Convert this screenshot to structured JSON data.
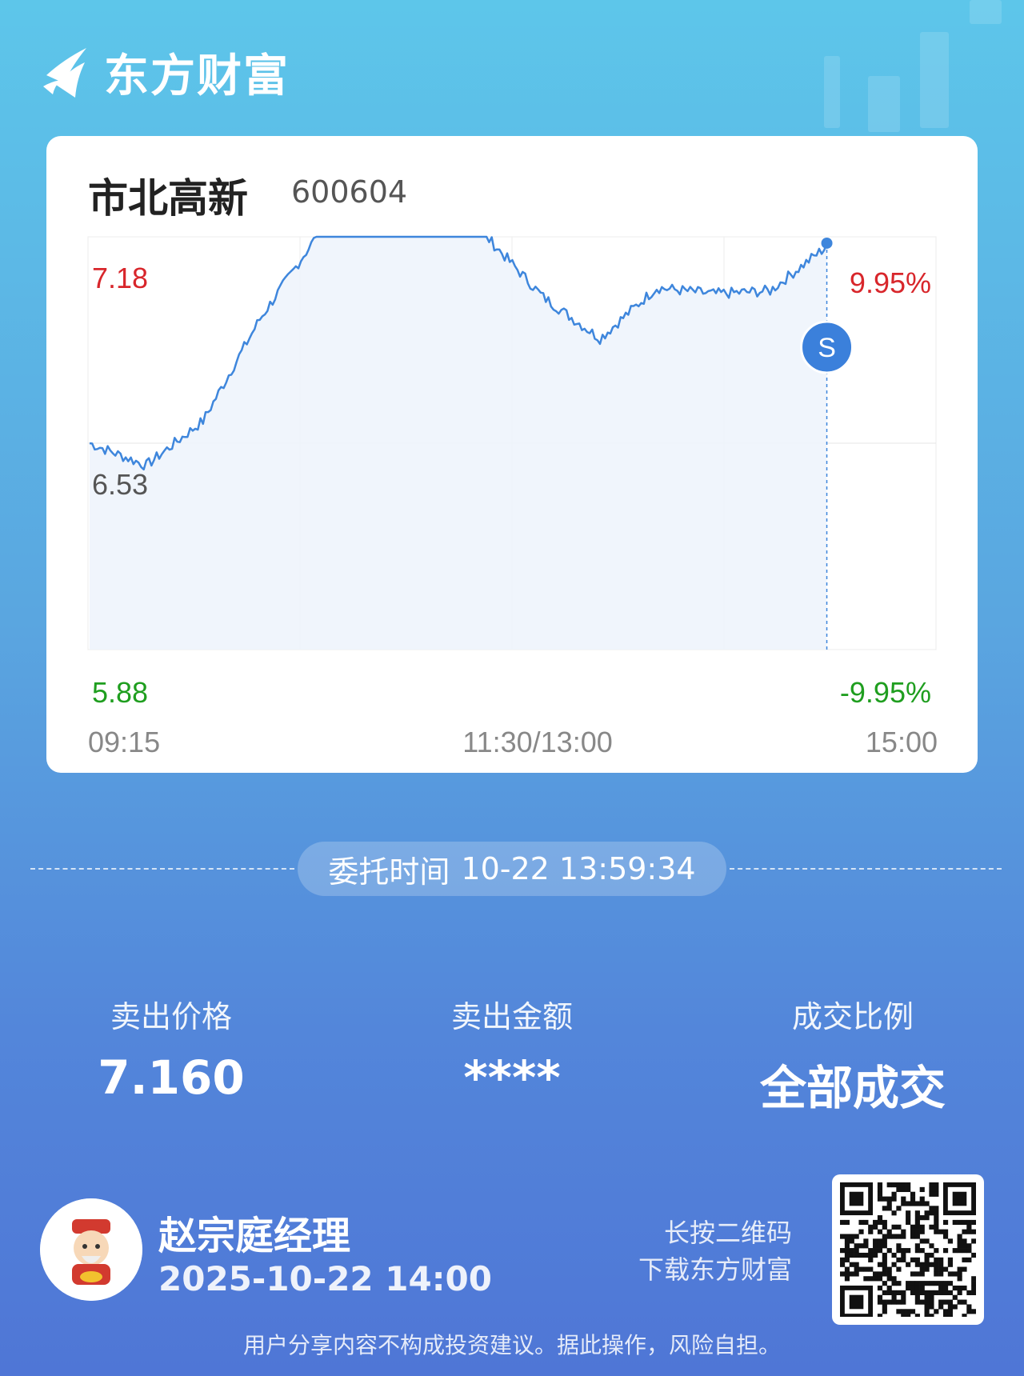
{
  "brand": {
    "name": "东方财富"
  },
  "stock": {
    "name": "市北高新",
    "code": "600604"
  },
  "chart_data": {
    "type": "line",
    "price_axis": {
      "max": "7.18",
      "mid": "6.53",
      "min": "5.88"
    },
    "pct_axis": {
      "max": "9.95%",
      "min": "-9.95%"
    },
    "time_labels": [
      "09:15",
      "11:30/13:00",
      "15:00"
    ],
    "ylim": [
      5.88,
      7.18
    ],
    "x": [
      "09:15",
      "09:30",
      "09:45",
      "10:00",
      "10:15",
      "10:30",
      "10:45",
      "11:00",
      "11:15",
      "11:30",
      "13:15",
      "13:30",
      "13:45",
      "14:00"
    ],
    "series": [
      {
        "values": [
          6.53,
          6.46,
          6.6,
          6.92,
          7.18,
          7.18,
          7.18,
          7.18,
          6.99,
          6.86,
          7.02,
          7.0,
          7.01,
          7.15
        ]
      }
    ],
    "marker": {
      "label": "S",
      "time": "13:59",
      "value": 7.16
    },
    "grid": true
  },
  "order": {
    "label": "委托时间",
    "time": "10-22 13:59:34"
  },
  "stats": [
    {
      "label": "卖出价格",
      "value": "7.160"
    },
    {
      "label": "卖出金额",
      "value": "****"
    },
    {
      "label": "成交比例",
      "value": "全部成交"
    }
  ],
  "footer": {
    "manager": "赵宗庭经理",
    "share_time": "2025-10-22 14:00",
    "qr_hint_line1": "长按二维码",
    "qr_hint_line2": "下载东方财富",
    "disclaimer": "用户分享内容不构成投资建议。据此操作，风险自担。"
  },
  "colors": {
    "up": "#d8262b",
    "down": "#1f9e1f",
    "line": "#3e86dc",
    "accent": "#3b80db"
  }
}
